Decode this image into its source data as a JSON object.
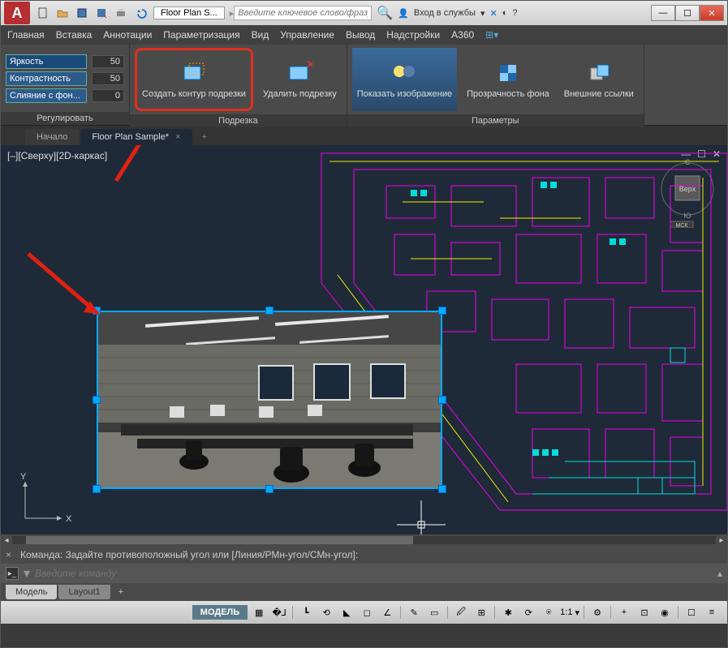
{
  "app": {
    "logo_letter": "A",
    "doc_title": "Floor Plan S...",
    "search_placeholder": "Введите ключевое слово/фразу",
    "login_label": "Вход в службы"
  },
  "menubar": [
    "Главная",
    "Вставка",
    "Аннотации",
    "Параметризация",
    "Вид",
    "Управление",
    "Вывод",
    "Надстройки",
    "A360"
  ],
  "ribbon": {
    "adjust": {
      "title": "Регулировать",
      "rows": [
        {
          "label": "Яркость",
          "value": "50"
        },
        {
          "label": "Контрастность",
          "value": "50"
        },
        {
          "label": "Слияние с фон...",
          "value": "0"
        }
      ]
    },
    "clip": {
      "title": "Подрезка",
      "create": "Создать контур подрезки",
      "remove": "Удалить подрезку"
    },
    "params": {
      "title": "Параметры",
      "show": "Показать изображение",
      "transparency": "Прозрачность фона",
      "xrefs": "Внешние ссылки"
    }
  },
  "filetabs": {
    "start": "Начало",
    "active": "Floor Plan Sample*"
  },
  "canvas": {
    "view_label": "[–][Сверху][2D-каркас]",
    "cube_top": "Верх",
    "cube_dir_n": "С",
    "cube_dir_s": "Ю",
    "cube_wcs": "МСК",
    "ucs_x": "X",
    "ucs_y": "Y"
  },
  "cmd": {
    "history": "Команда: Задайте противоположный угол или [Линия/РМн-угол/СМн-угол]:",
    "placeholder": "Введите команду"
  },
  "layout": {
    "model": "Модель",
    "layout1": "Layout1"
  },
  "status": {
    "model": "МОДЕЛЬ",
    "scale": "1:1"
  }
}
